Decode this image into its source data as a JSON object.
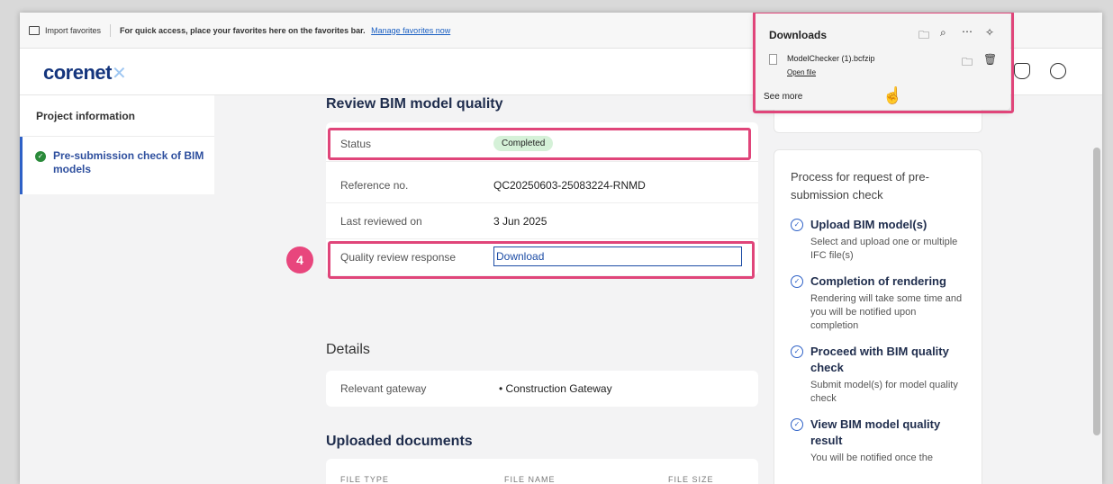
{
  "favorites_bar": {
    "import_label": "Import favorites",
    "message": "For quick access, place your favorites here on the favorites bar.",
    "manage_link": "Manage favorites now"
  },
  "header": {
    "logo_text": "corenet",
    "logo_suffix": "✕",
    "icons": [
      "notification-icon",
      "profile-icon"
    ]
  },
  "sidebar": {
    "project_info": "Project information",
    "active_item": "Pre-submission check of BIM models"
  },
  "review": {
    "title": "Review BIM model quality",
    "rows": {
      "status_label": "Status",
      "status_value": "Completed",
      "ref_label": "Reference no.",
      "ref_value": "QC20250603-25083224-RNMD",
      "reviewed_label": "Last reviewed on",
      "reviewed_value": "3 Jun 2025",
      "response_label": "Quality review response",
      "response_value": "Download"
    },
    "step_number": "4"
  },
  "details": {
    "title": "Details",
    "gateway_label": "Relevant gateway",
    "gateway_value": "• Construction Gateway"
  },
  "uploaded": {
    "title": "Uploaded documents",
    "columns": [
      "FILE TYPE",
      "FILE NAME",
      "FILE SIZE"
    ]
  },
  "process": {
    "title": "Process for request of pre-submission check",
    "steps": [
      {
        "heading": "Upload BIM model(s)",
        "desc": "Select and upload one or multiple IFC file(s)"
      },
      {
        "heading": "Completion of rendering",
        "desc": "Rendering will take some time and you will be notified upon completion"
      },
      {
        "heading": "Proceed with BIM quality check",
        "desc": "Submit model(s) for model quality check"
      },
      {
        "heading": "View BIM model quality result",
        "desc": "You will be notified once the"
      }
    ]
  },
  "downloads": {
    "title": "Downloads",
    "file_name": "ModelChecker (1).bcfzip",
    "open_file": "Open file",
    "see_more": "See more"
  },
  "colors": {
    "accent": "#2e61c7",
    "highlight": "#e0457a",
    "badge_bg": "#d5f1d8",
    "brand": "#14357d"
  }
}
